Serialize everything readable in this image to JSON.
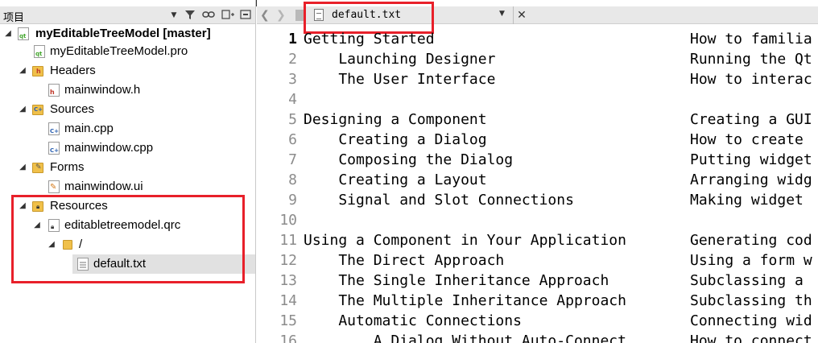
{
  "project_pane": {
    "title": "项目"
  },
  "tree": [
    {
      "label": "myEditableTreeModel [master]",
      "bold": true,
      "icon": "qt-project-icon"
    },
    {
      "label": "myEditableTreeModel.pro",
      "icon": "qt-pro-file-icon"
    },
    {
      "label": "Headers",
      "icon": "headers-folder-icon"
    },
    {
      "label": "mainwindow.h",
      "icon": "header-file-icon"
    },
    {
      "label": "Sources",
      "icon": "sources-folder-icon"
    },
    {
      "label": "main.cpp",
      "icon": "cpp-file-icon"
    },
    {
      "label": "mainwindow.cpp",
      "icon": "cpp-file-icon"
    },
    {
      "label": "Forms",
      "icon": "forms-folder-icon"
    },
    {
      "label": "mainwindow.ui",
      "icon": "ui-file-icon"
    },
    {
      "label": "Resources",
      "icon": "resources-folder-icon"
    },
    {
      "label": "editabletreemodel.qrc",
      "icon": "qrc-file-icon"
    },
    {
      "label": "/",
      "icon": "folder-icon"
    },
    {
      "label": "default.txt",
      "icon": "text-file-icon"
    }
  ],
  "editor": {
    "tab_label": "default.txt",
    "line_numbers": [
      "1",
      "2",
      "3",
      "4",
      "5",
      "6",
      "7",
      "8",
      "9",
      "10",
      "11",
      "12",
      "13",
      "14",
      "15",
      "16"
    ],
    "lines": [
      {
        "left": "Getting Started",
        "right": "How to familia"
      },
      {
        "left": "    Launching Designer",
        "right": "Running the Qt"
      },
      {
        "left": "    The User Interface",
        "right": "How to interac"
      },
      {
        "left": "",
        "right": ""
      },
      {
        "left": "Designing a Component",
        "right": "Creating a GUI"
      },
      {
        "left": "    Creating a Dialog",
        "right": "How to create"
      },
      {
        "left": "    Composing the Dialog",
        "right": "Putting widget"
      },
      {
        "left": "    Creating a Layout",
        "right": "Arranging widg"
      },
      {
        "left": "    Signal and Slot Connections",
        "right": "Making widget"
      },
      {
        "left": "",
        "right": ""
      },
      {
        "left": "Using a Component in Your Application",
        "right": "Generating cod"
      },
      {
        "left": "    The Direct Approach",
        "right": "Using a form w"
      },
      {
        "left": "    The Single Inheritance Approach",
        "right": "Subclassing a"
      },
      {
        "left": "    The Multiple Inheritance Approach",
        "right": "Subclassing th"
      },
      {
        "left": "    Automatic Connections",
        "right": "Connecting wid"
      },
      {
        "left": "        A Dialog Without Auto-Connect",
        "right": "How to connect"
      }
    ]
  },
  "colors": {
    "highlight_box": "#e8202a",
    "selection": "#e1e1e1",
    "toolbar": "#e8e8e8"
  }
}
